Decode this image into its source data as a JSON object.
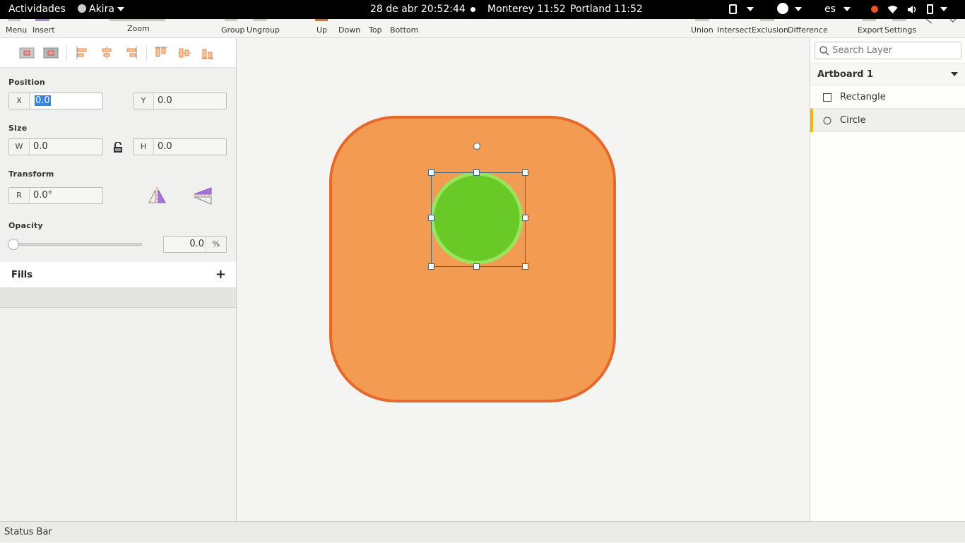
{
  "topbar": {
    "activities": "Actividades",
    "app_name": "Akira",
    "datetime": "28 de abr  20:52:44",
    "clock1": "Monterey 11:52",
    "clock2": "Portland 11:52",
    "lang": "es",
    "dot_color": "#e95420"
  },
  "toolbar": {
    "menu": "Menu",
    "insert": "Insert",
    "zoom": "Zoom",
    "group": "Group",
    "ungroup": "Ungroup",
    "up": "Up",
    "down": "Down",
    "top": "Top",
    "bottom": "Bottom",
    "union": "Union",
    "intersect": "Intersect",
    "exclusion": "Exclusion",
    "difference": "Difference",
    "export": "Export",
    "settings": "Settings"
  },
  "properties": {
    "position_label": "Position",
    "x_label": "X",
    "x_value": "0.0",
    "y_label": "Y",
    "y_value": "0.0",
    "size_label": "Size",
    "w_label": "W",
    "w_value": "0.0",
    "h_label": "H",
    "h_value": "0.0",
    "transform_label": "Transform",
    "r_label": "R",
    "r_value": "0.0°",
    "opacity_label": "Opacity",
    "opacity_value": "0.0",
    "opacity_unit": "%",
    "opacity_level": 0,
    "fills_label": "Fills",
    "fills_add": "+"
  },
  "canvas": {
    "rect_fill": "#f39b53",
    "rect_stroke": "#e6692c",
    "circle_fill": "#68c927",
    "circle_stroke": "#9be35a"
  },
  "layers": {
    "search_placeholder": "Search Layer",
    "artboard": "Artboard 1",
    "items": [
      {
        "name": "Rectangle",
        "icon": "square-icon",
        "selected": false
      },
      {
        "name": "Circle",
        "icon": "circle-icon",
        "selected": true
      }
    ],
    "selection_color": "#f5b800"
  },
  "status": "Status Bar"
}
